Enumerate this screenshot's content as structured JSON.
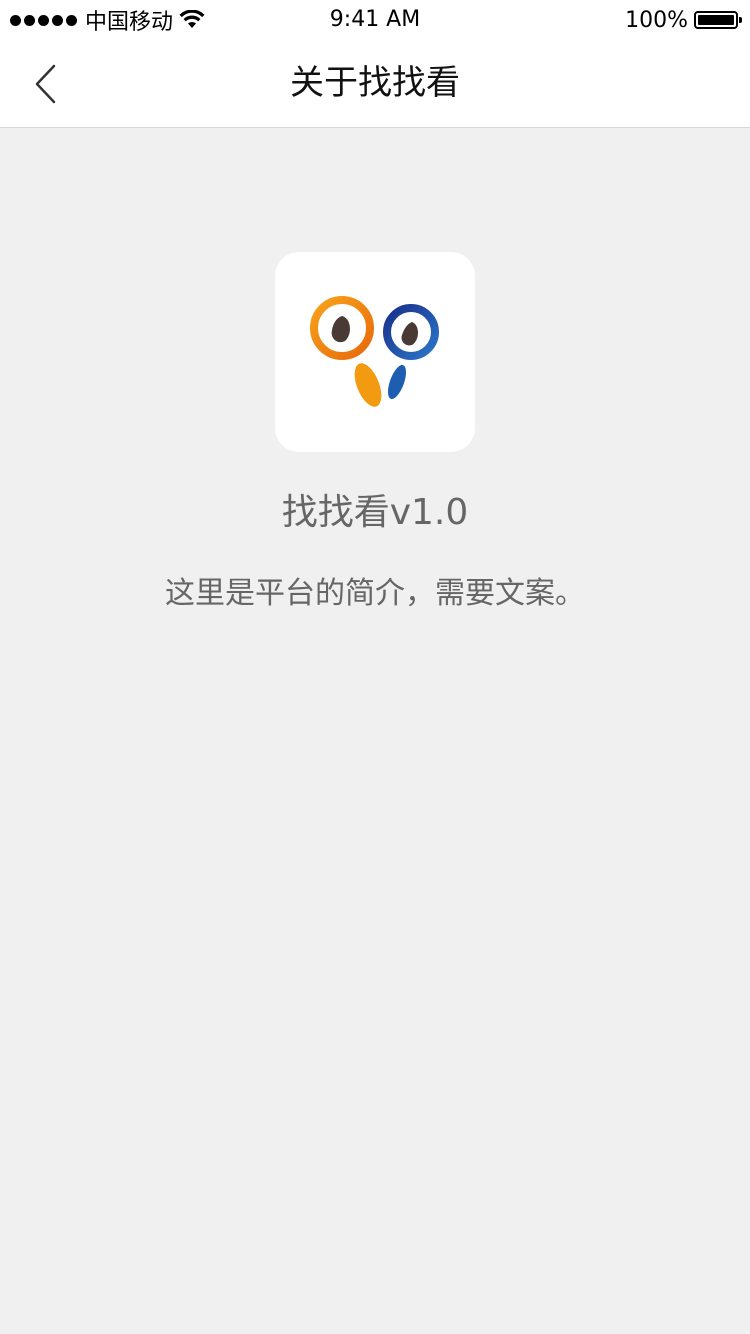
{
  "status_bar": {
    "carrier": "中国移动",
    "time": "9:41 AM",
    "battery_percent": "100%"
  },
  "nav": {
    "title": "关于找找看",
    "back_icon": "chevron-left-icon"
  },
  "about": {
    "version": "找找看v1.0",
    "intro": "这里是平台的简介，需要文案。"
  },
  "colors": {
    "background": "#f0f0f0",
    "bar": "#ffffff",
    "text_secondary": "#666666",
    "logo_orange": "#f29a10",
    "logo_blue": "#1e4fa8"
  }
}
